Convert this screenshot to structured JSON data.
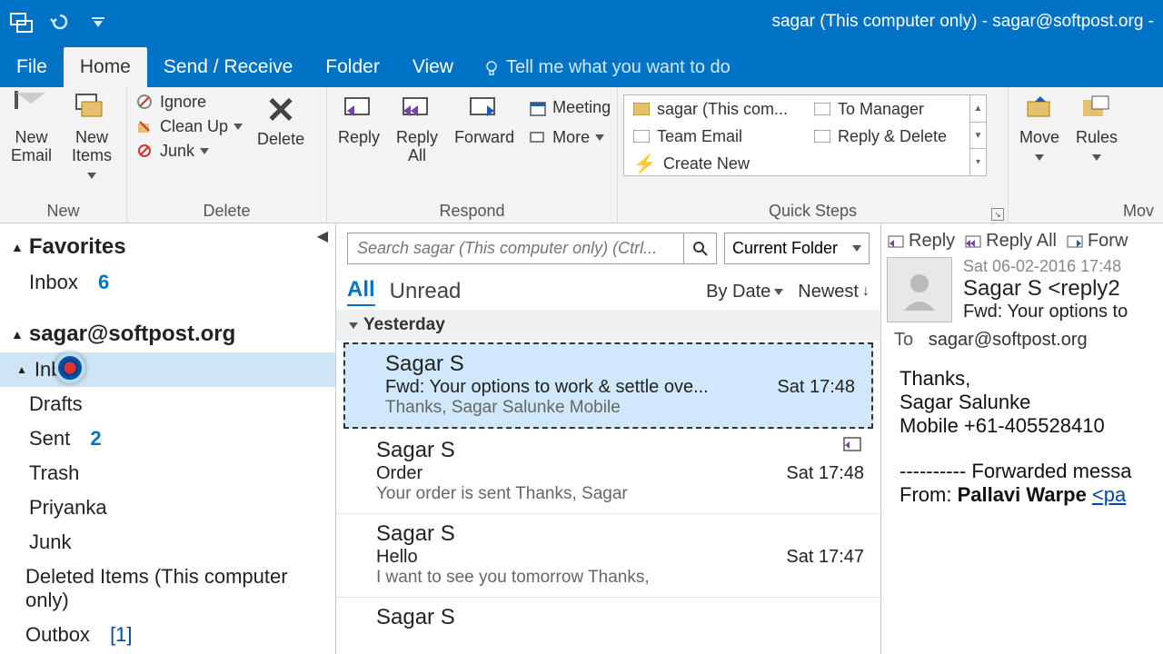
{
  "title": "sagar (This computer only) - sagar@softpost.org - ",
  "tabs": {
    "file": "File",
    "home": "Home",
    "send_receive": "Send / Receive",
    "folder": "Folder",
    "view": "View",
    "tell_me": "Tell me what you want to do"
  },
  "ribbon": {
    "new": {
      "label": "New",
      "new_email": "New\nEmail",
      "new_items": "New\nItems"
    },
    "delete": {
      "label": "Delete",
      "ignore": "Ignore",
      "clean_up": "Clean Up",
      "junk": "Junk",
      "delete": "Delete"
    },
    "respond": {
      "label": "Respond",
      "reply": "Reply",
      "reply_all": "Reply\nAll",
      "forward": "Forward",
      "meeting": "Meeting",
      "more": "More"
    },
    "quick_steps": {
      "label": "Quick Steps",
      "items": [
        "sagar (This com...",
        "Team Email",
        "Create New",
        "To Manager",
        "Reply & Delete"
      ]
    },
    "move": {
      "label": "Mov",
      "move": "Move",
      "rules": "Rules"
    }
  },
  "nav": {
    "favorites": "Favorites",
    "fav_inbox": {
      "label": "Inbox",
      "count": "6"
    },
    "account": "sagar@softpost.org",
    "inbox": {
      "label": "Inbo"
    },
    "drafts": "Drafts",
    "sent": {
      "label": "Sent",
      "count": "2"
    },
    "trash": "Trash",
    "priyanka": "Priyanka",
    "junk": "Junk",
    "deleted": "Deleted Items (This computer only)",
    "outbox": {
      "label": "Outbox",
      "count": "[1]"
    }
  },
  "list": {
    "search_placeholder": "Search sagar (This computer only) (Ctrl...",
    "scope": "Current Folder",
    "filter_all": "All",
    "filter_unread": "Unread",
    "sort_by": "By Date",
    "sort_order": "Newest",
    "group": "Yesterday",
    "messages": [
      {
        "from": "Sagar S",
        "subject": "Fwd: Your options to work & settle ove...",
        "time": "Sat 17:48",
        "preview": "Thanks,  Sagar Salunke  Mobile"
      },
      {
        "from": "Sagar S",
        "subject": "Order",
        "time": "Sat 17:48",
        "preview": "Your order is sent   Thanks,  Sagar"
      },
      {
        "from": "Sagar S",
        "subject": "Hello",
        "time": "Sat 17:47",
        "preview": "I want to see you tomorrow  Thanks,"
      },
      {
        "from": "Sagar S",
        "subject": "",
        "time": "",
        "preview": ""
      }
    ]
  },
  "reading": {
    "actions": {
      "reply": "Reply",
      "reply_all": "Reply All",
      "forward": "Forw"
    },
    "date": "Sat 06-02-2016 17:48",
    "from": "Sagar S <reply2",
    "subject": "Fwd: Your options to",
    "to_label": "To",
    "to": "sagar@softpost.org",
    "body_thanks": "Thanks,",
    "body_name": "Sagar Salunke",
    "body_mobile": "Mobile +61-405528410",
    "fwd_line": "---------- Forwarded messa",
    "fwd_from_label": "From: ",
    "fwd_from_name": "Pallavi Warpe ",
    "fwd_from_link": "<pa"
  }
}
